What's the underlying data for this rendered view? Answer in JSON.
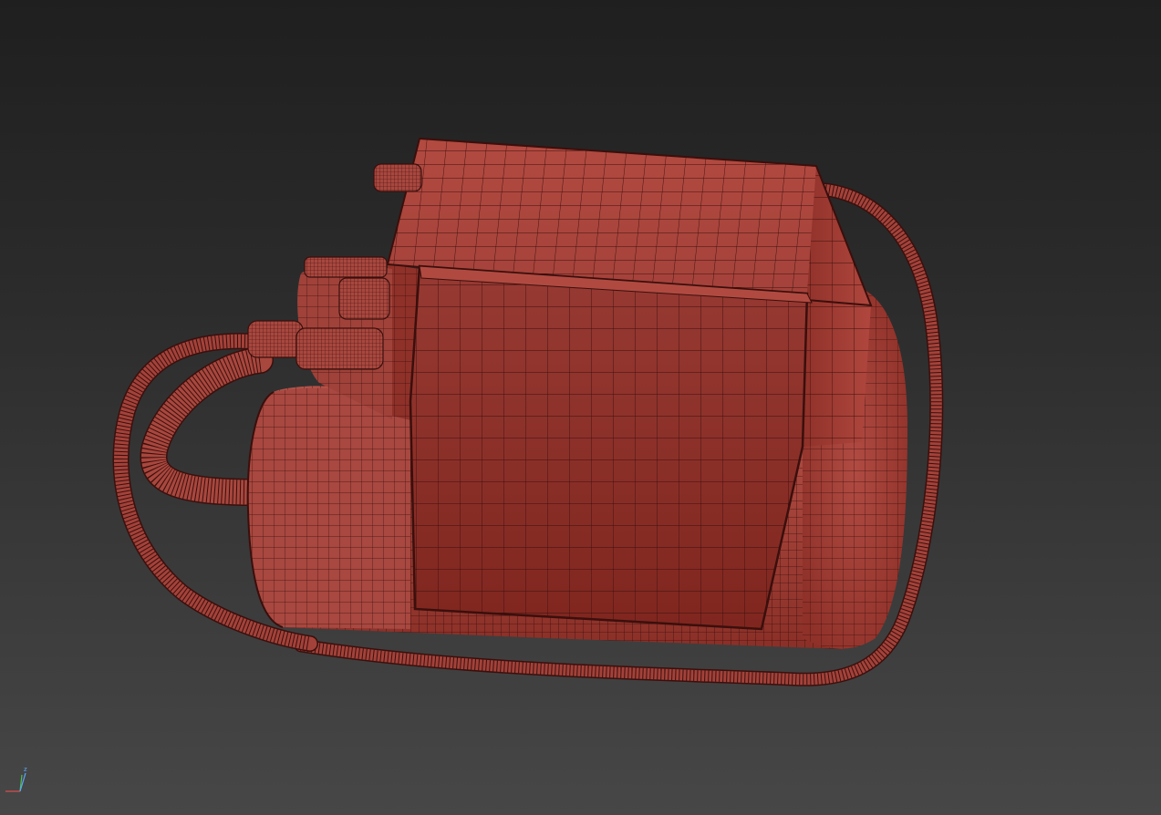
{
  "viewport": {
    "background_top": "#1f1f1f",
    "background_bottom": "#474747"
  },
  "model": {
    "shading": "wireframe-over-shaded",
    "base_color": "#a8423a",
    "wire_color": "#3a0f0c",
    "parts": [
      "upper-box",
      "front-panel",
      "main-cylinder",
      "cable-loop-right",
      "cable-loop-left",
      "connector-fittings",
      "top-pin"
    ]
  },
  "axis_gizmo": {
    "axes": [
      "x",
      "y",
      "z"
    ],
    "z_label": "z",
    "x_color": "#e05050",
    "y_color": "#50c050",
    "z_color": "#5aa8ff"
  }
}
